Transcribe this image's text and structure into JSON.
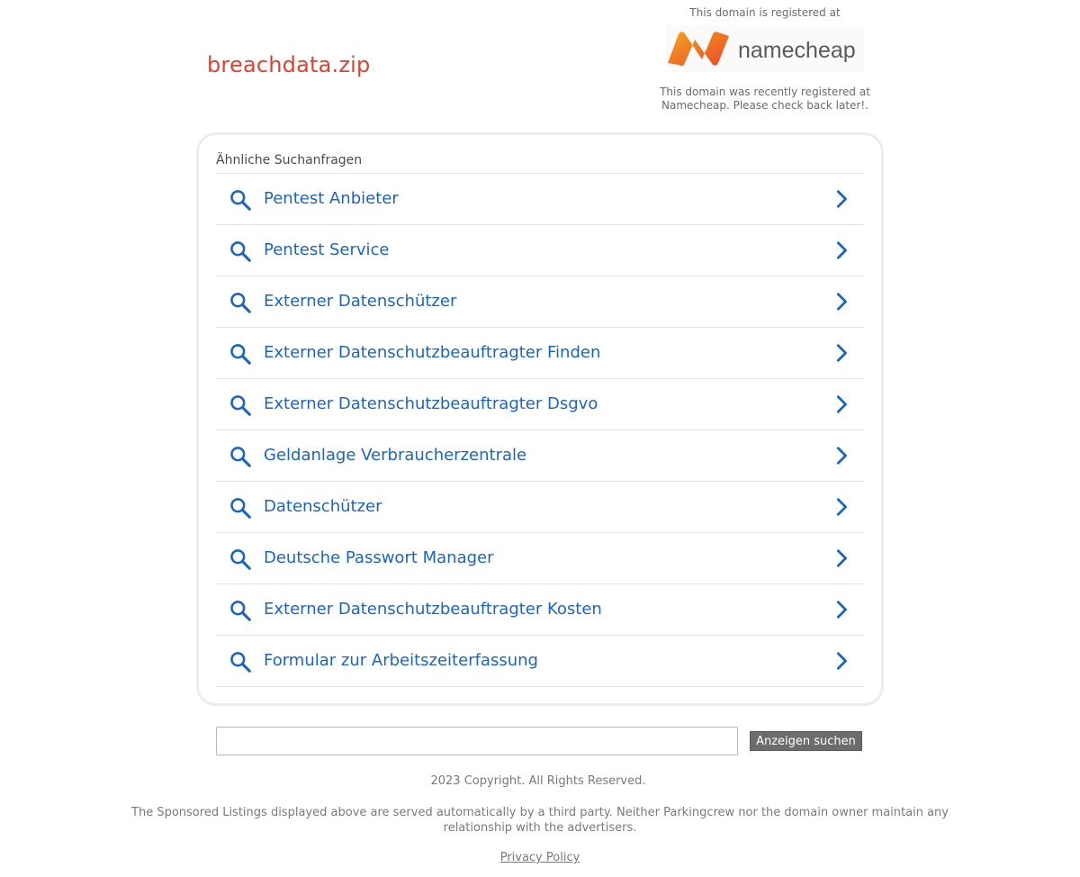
{
  "domain": "breachdata.zip",
  "registrar": {
    "top_text": "This domain is registered at",
    "logo_text": "namecheap",
    "bottom_text": "This domain was recently registered at Namecheap. Please check back later!."
  },
  "related": {
    "heading": "Ähnliche Suchanfragen",
    "items": [
      {
        "label": "Pentest Anbieter"
      },
      {
        "label": "Pentest Service"
      },
      {
        "label": "Externer Datenschützer"
      },
      {
        "label": "Externer Datenschutzbeauftragter Finden"
      },
      {
        "label": "Externer Datenschutzbeauftragter Dsgvo"
      },
      {
        "label": "Geldanlage Verbraucherzentrale"
      },
      {
        "label": "Datenschützer"
      },
      {
        "label": "Deutsche Passwort Manager"
      },
      {
        "label": "Externer Datenschutzbeauftragter Kosten"
      },
      {
        "label": "Formular zur Arbeitszeiterfassung"
      }
    ]
  },
  "search": {
    "value": "",
    "button_label": "Anzeigen suchen"
  },
  "footer": {
    "copyright": "2023 Copyright. All Rights Reserved.",
    "disclaimer": "The Sponsored Listings displayed above are served automatically by a third party. Neither Parkingcrew nor the domain owner maintain any relationship with the advertisers.",
    "privacy_label": "Privacy Policy"
  },
  "colors": {
    "domain_title": "#d9432f",
    "link": "#1a64c4",
    "brand_orange": "#f05a28",
    "button_bg": "#6c6c6c"
  },
  "icons": {
    "item_left": "search-icon",
    "item_right": "chevron-right-icon"
  }
}
